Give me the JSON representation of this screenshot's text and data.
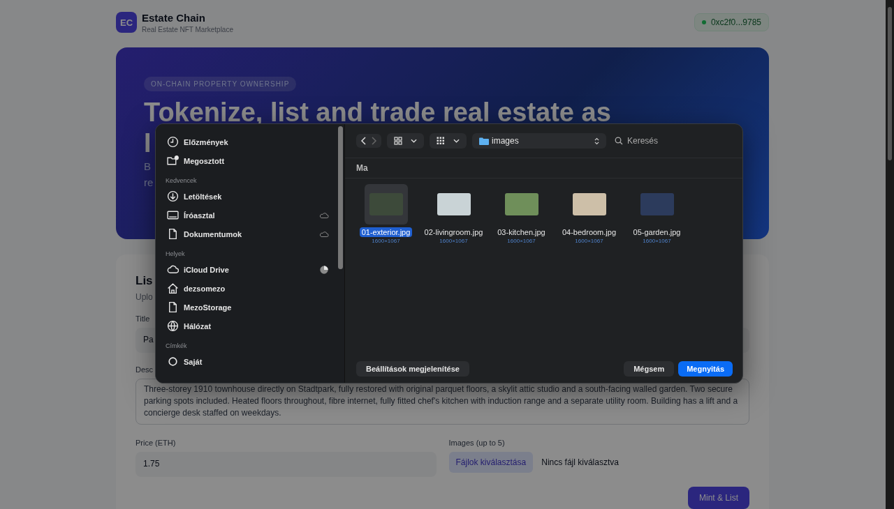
{
  "header": {
    "logo": "EC",
    "title": "Estate Chain",
    "subtitle": "Real Estate NFT Marketplace",
    "wallet": {
      "address": "0xc2f0...9785",
      "connected": true
    }
  },
  "hero": {
    "badge": "ON-CHAIN PROPERTY OWNERSHIP",
    "title_lines": [
      "Tokenize, list and trade real estate as",
      "I"
    ],
    "description_lines": [
      "B",
      "re"
    ]
  },
  "form": {
    "title": "Lis",
    "subtitle": "Uplo",
    "title_field": {
      "label": "Title",
      "value": "Pa"
    },
    "description_field": {
      "label": "Desc",
      "value": "Three-storey 1910 townhouse directly on Stadtpark, fully restored with original parquet floors, a skylit attic studio and a south-facing walled garden. Two secure parking spots included. Heated floors throughout, fibre internet, fully fitted chef's kitchen with induction range and a separate utility room. Building has a lift and a concierge desk staffed on weekdays."
    },
    "price_field": {
      "label": "Price (ETH)",
      "value": "1.75"
    },
    "images_field": {
      "label": "Images (up to 5)",
      "button": "Fájlok kiválasztása",
      "status": "Nincs fájl kiválasztva"
    },
    "submit": "Mint & List"
  },
  "dialog": {
    "sidebar": [
      {
        "items": [
          {
            "label": "Előzmények",
            "kind": "clock"
          },
          {
            "label": "Megosztott",
            "kind": "shared"
          }
        ]
      },
      {
        "heading": "Kedvencek",
        "items": [
          {
            "label": "Letöltések",
            "kind": "download"
          },
          {
            "label": "Íróasztal",
            "kind": "desktop",
            "in_cloud": true
          },
          {
            "label": "Dokumentumok",
            "kind": "document",
            "in_cloud": true
          }
        ]
      },
      {
        "heading": "Helyek",
        "items": [
          {
            "label": "iCloud Drive",
            "kind": "cloud",
            "syncing": true
          },
          {
            "label": "dezsomezo",
            "kind": "home"
          },
          {
            "label": "MezoStorage",
            "kind": "document"
          },
          {
            "label": "Hálózat",
            "kind": "globe"
          }
        ]
      },
      {
        "heading": "Címkék",
        "items": [
          {
            "label": "Saját",
            "kind": "tag"
          }
        ]
      }
    ],
    "location": "images",
    "search_placeholder": "Keresés",
    "group": "Ma",
    "files": [
      {
        "name": "01-exterior.jpg",
        "size": "1600×1067",
        "selected": true
      },
      {
        "name": "02-livingroom.jpg",
        "size": "1600×1067",
        "selected": false
      },
      {
        "name": "03-kitchen.jpg",
        "size": "1600×1067",
        "selected": false
      },
      {
        "name": "04-bedroom.jpg",
        "size": "1600×1067",
        "selected": false
      },
      {
        "name": "05-garden.jpg",
        "size": "1600×1067",
        "selected": false
      }
    ],
    "options_button": "Beállítások megjelenítése",
    "cancel_button": "Mégsem",
    "open_button": "Megnyitás"
  }
}
